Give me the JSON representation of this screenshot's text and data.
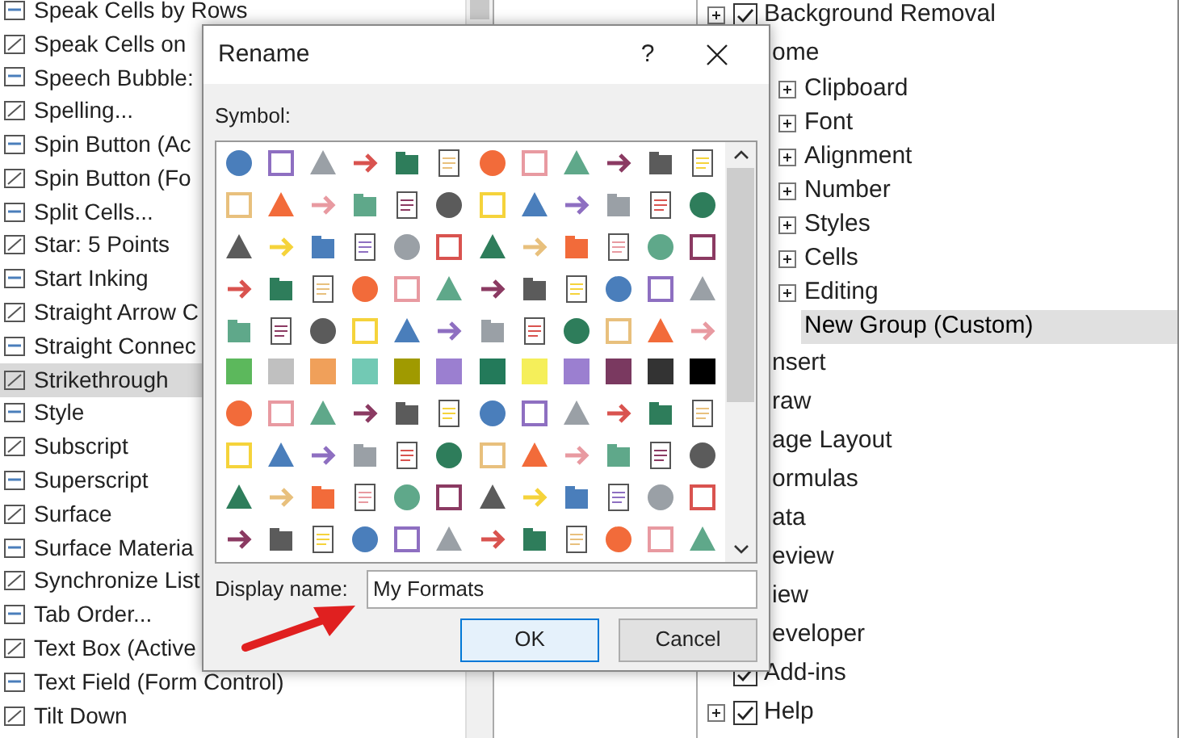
{
  "commands_list": {
    "items": [
      {
        "label": "Speak Cells by Rows",
        "selected": false
      },
      {
        "label": "Speak Cells on",
        "selected": false
      },
      {
        "label": "Speech Bubble:",
        "selected": false
      },
      {
        "label": "Spelling...",
        "selected": false
      },
      {
        "label": "Spin Button (Ac",
        "selected": false
      },
      {
        "label": "Spin Button (Fo",
        "selected": false
      },
      {
        "label": "Split Cells...",
        "selected": false
      },
      {
        "label": "Star: 5 Points",
        "selected": false
      },
      {
        "label": "Start Inking",
        "selected": false
      },
      {
        "label": "Straight Arrow C",
        "selected": false
      },
      {
        "label": "Straight Connec",
        "selected": false
      },
      {
        "label": "Strikethrough",
        "selected": true
      },
      {
        "label": "Style",
        "selected": false
      },
      {
        "label": "Subscript",
        "selected": false
      },
      {
        "label": "Superscript",
        "selected": false
      },
      {
        "label": "Surface",
        "selected": false
      },
      {
        "label": "Surface Materia",
        "selected": false
      },
      {
        "label": "Synchronize List",
        "selected": false
      },
      {
        "label": "Tab Order...",
        "selected": false
      },
      {
        "label": "Text Box (Active",
        "selected": false
      },
      {
        "label": "Text Field (Form Control)",
        "selected": false
      },
      {
        "label": "Tilt Down",
        "selected": false
      }
    ]
  },
  "ribbon_tree": {
    "items": [
      {
        "label": "Background Removal",
        "expander": true,
        "checked": true,
        "selected": false
      },
      {
        "label": "ome",
        "selected": false,
        "children": [
          {
            "label": "Clipboard",
            "expander": true,
            "selected": false
          },
          {
            "label": "Font",
            "expander": true,
            "selected": false
          },
          {
            "label": "Alignment",
            "expander": true,
            "selected": false
          },
          {
            "label": "Number",
            "expander": true,
            "selected": false
          },
          {
            "label": "Styles",
            "expander": true,
            "selected": false
          },
          {
            "label": "Cells",
            "expander": true,
            "selected": false
          },
          {
            "label": "Editing",
            "expander": true,
            "selected": false
          },
          {
            "label": "New Group (Custom)",
            "expander": false,
            "selected": true
          }
        ]
      },
      {
        "label": "nsert",
        "selected": false
      },
      {
        "label": "raw",
        "selected": false
      },
      {
        "label": "age Layout",
        "selected": false
      },
      {
        "label": "ormulas",
        "selected": false
      },
      {
        "label": "ata",
        "selected": false
      },
      {
        "label": "eview",
        "selected": false
      },
      {
        "label": "iew",
        "selected": false
      },
      {
        "label": "eveloper",
        "selected": false
      },
      {
        "label": "Add-ins",
        "expander": false,
        "checked": true,
        "selected": false
      },
      {
        "label": "Help",
        "expander": true,
        "checked": true,
        "selected": false
      }
    ]
  },
  "dialog": {
    "title": "Rename",
    "help": "?",
    "symbol_label": "Symbol:",
    "display_name_label": "Display name:",
    "display_name_value": "My Formats",
    "buttons": [
      {
        "label": "OK",
        "default": true
      },
      {
        "label": "Cancel",
        "default": false
      }
    ]
  }
}
